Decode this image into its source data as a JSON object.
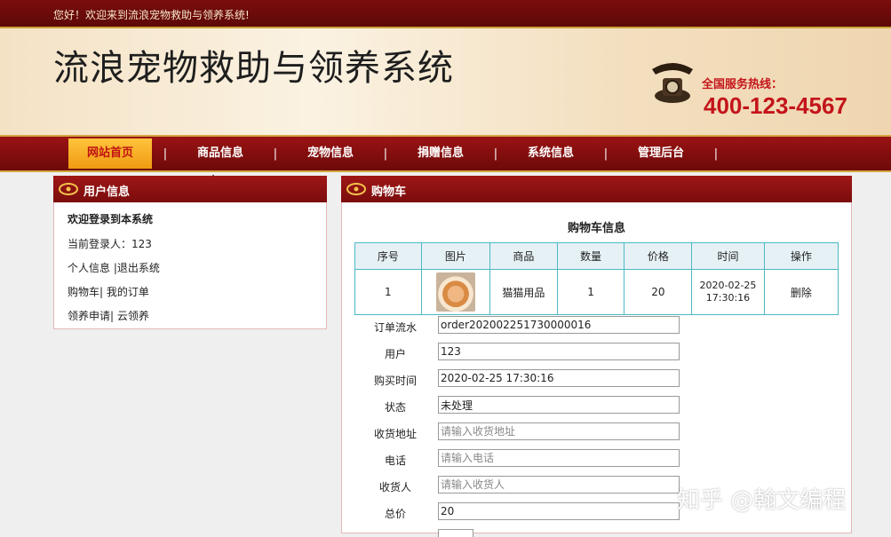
{
  "header": {
    "welcome": "您好！欢迎来到流浪宠物救助与领养系统!",
    "site_title": "流浪宠物救助与领养系统",
    "hotline_label": "全国服务热线：",
    "hotline_number": "400-123-4567"
  },
  "nav": {
    "items": [
      {
        "label": "网站首页"
      },
      {
        "label": "商品信息"
      },
      {
        "label": "宠物信息"
      },
      {
        "label": "捐赠信息"
      },
      {
        "label": "系统信息"
      },
      {
        "label": "管理后台"
      }
    ],
    "separator": "|"
  },
  "user_panel": {
    "title": "用户信息",
    "welcome": "欢迎登录到本系统",
    "current_user_label": "当前登录人：",
    "current_user": "123",
    "link_profile": "个人信息",
    "link_logout": "|退出系统",
    "link_cart": "购物车|",
    "link_orders": "我的订单",
    "link_adopt_apply": "领养申请|",
    "link_cloud_adopt": "云领养"
  },
  "cart_panel": {
    "title": "购物车",
    "section_title": "购物车信息",
    "columns": [
      "序号",
      "图片",
      "商品",
      "数量",
      "价格",
      "时间",
      "操作"
    ],
    "rows": [
      {
        "index": "1",
        "image": "cat-photo",
        "product": "猫猫用品",
        "quantity": "1",
        "price": "20",
        "time_date": "2020-02-25",
        "time_clock": "17:30:16",
        "action": "删除"
      }
    ]
  },
  "order_form": {
    "order_no_label": "订单流水",
    "order_no": "order202002251730000016",
    "user_label": "用户",
    "user": "123",
    "buy_time_label": "购买时间",
    "buy_time": "2020-02-25 17:30:16",
    "status_label": "状态",
    "status": "未处理",
    "address_label": "收货地址",
    "address_placeholder": "请输入收货地址",
    "phone_label": "电话",
    "phone_placeholder": "请输入电话",
    "receiver_label": "收货人",
    "receiver_placeholder": "请输入收货人",
    "total_label": "总价",
    "total": "20"
  },
  "watermark": "知乎 @翰文编程",
  "colors": {
    "primary": "#8b0f0f",
    "accent": "#f5a623",
    "hotline": "#c4141b",
    "table_border": "#4cb8c4"
  }
}
